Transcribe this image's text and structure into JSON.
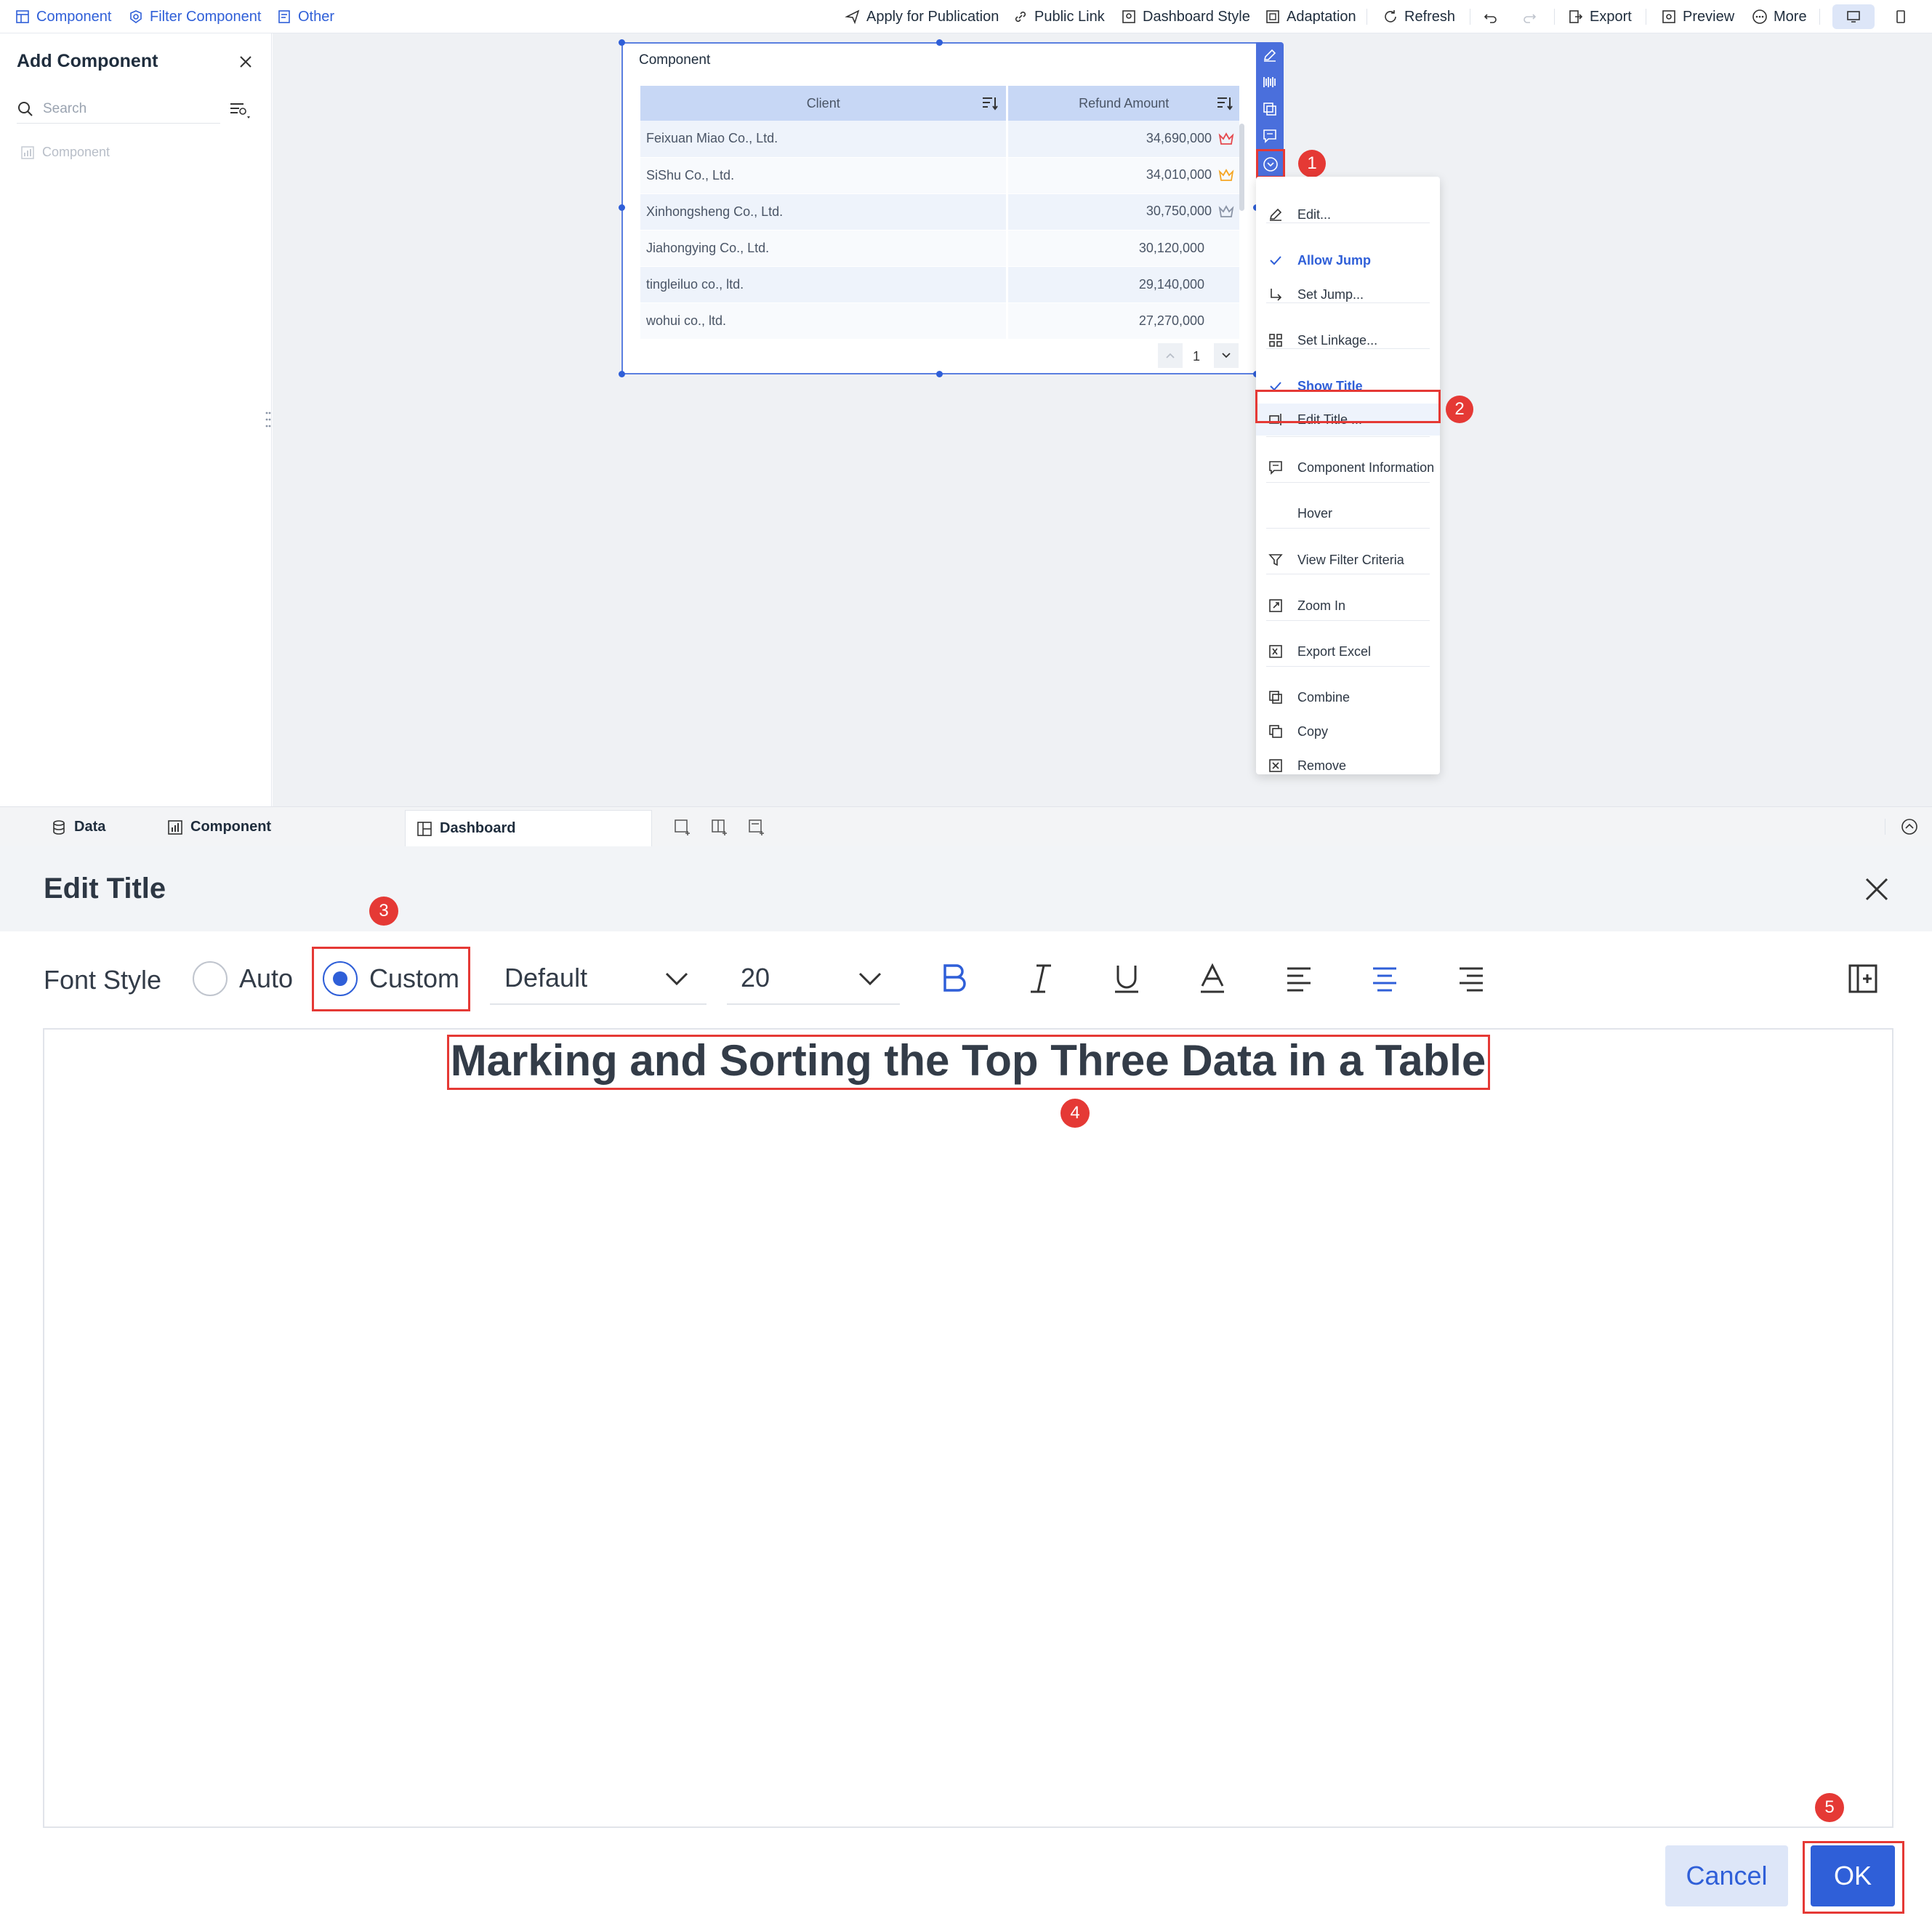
{
  "toolbar": {
    "left": [
      "Component",
      "Filter Component",
      "Other"
    ],
    "right": [
      "Apply for Publication",
      "Public Link",
      "Dashboard Style",
      "Adaptation",
      "Refresh",
      "Export",
      "Preview",
      "More"
    ]
  },
  "left_panel": {
    "title": "Add Component",
    "search_placeholder": "Search",
    "tree_item": "Component"
  },
  "widget": {
    "title": "Component",
    "columns": [
      "Client",
      "Refund Amount"
    ],
    "rows": [
      {
        "client": "Feixuan Miao Co., Ltd.",
        "amount": "34,690,000",
        "crown": "#e5484d"
      },
      {
        "client": "SiShu Co., Ltd.",
        "amount": "34,010,000",
        "crown": "#f5a623"
      },
      {
        "client": "Xinhongsheng Co., Ltd.",
        "amount": "30,750,000",
        "crown": "#8a94a6"
      },
      {
        "client": "Jiahongying Co., Ltd.",
        "amount": "30,120,000",
        "crown": ""
      },
      {
        "client": "tingleiluo co., ltd.",
        "amount": "29,140,000",
        "crown": ""
      },
      {
        "client": "wohui co., ltd.",
        "amount": "27,270,000",
        "crown": ""
      }
    ],
    "page": "1"
  },
  "menu": {
    "items": [
      "Edit...",
      "Allow Jump",
      "Set Jump...",
      "Set Linkage...",
      "Show Title",
      "Edit Title ...",
      "Component Information",
      "Hover",
      "View Filter Criteria",
      "Zoom In",
      "Export Excel",
      "Combine",
      "Copy",
      "Remove"
    ]
  },
  "bottom_tabs": [
    "Data",
    "Component",
    "Dashboard"
  ],
  "dialog": {
    "title": "Edit Title",
    "font_style_label": "Font Style",
    "auto_label": "Auto",
    "custom_label": "Custom",
    "font_family": "Default",
    "font_size": "20",
    "title_text": "Marking and Sorting the Top Three Data in a Table",
    "cancel_label": "Cancel",
    "ok_label": "OK"
  },
  "markers": [
    "1",
    "2",
    "3",
    "4",
    "5"
  ],
  "colors": {
    "accent": "#2f5fd8",
    "marker": "#e53935",
    "header_bg": "#c7d7f5"
  }
}
